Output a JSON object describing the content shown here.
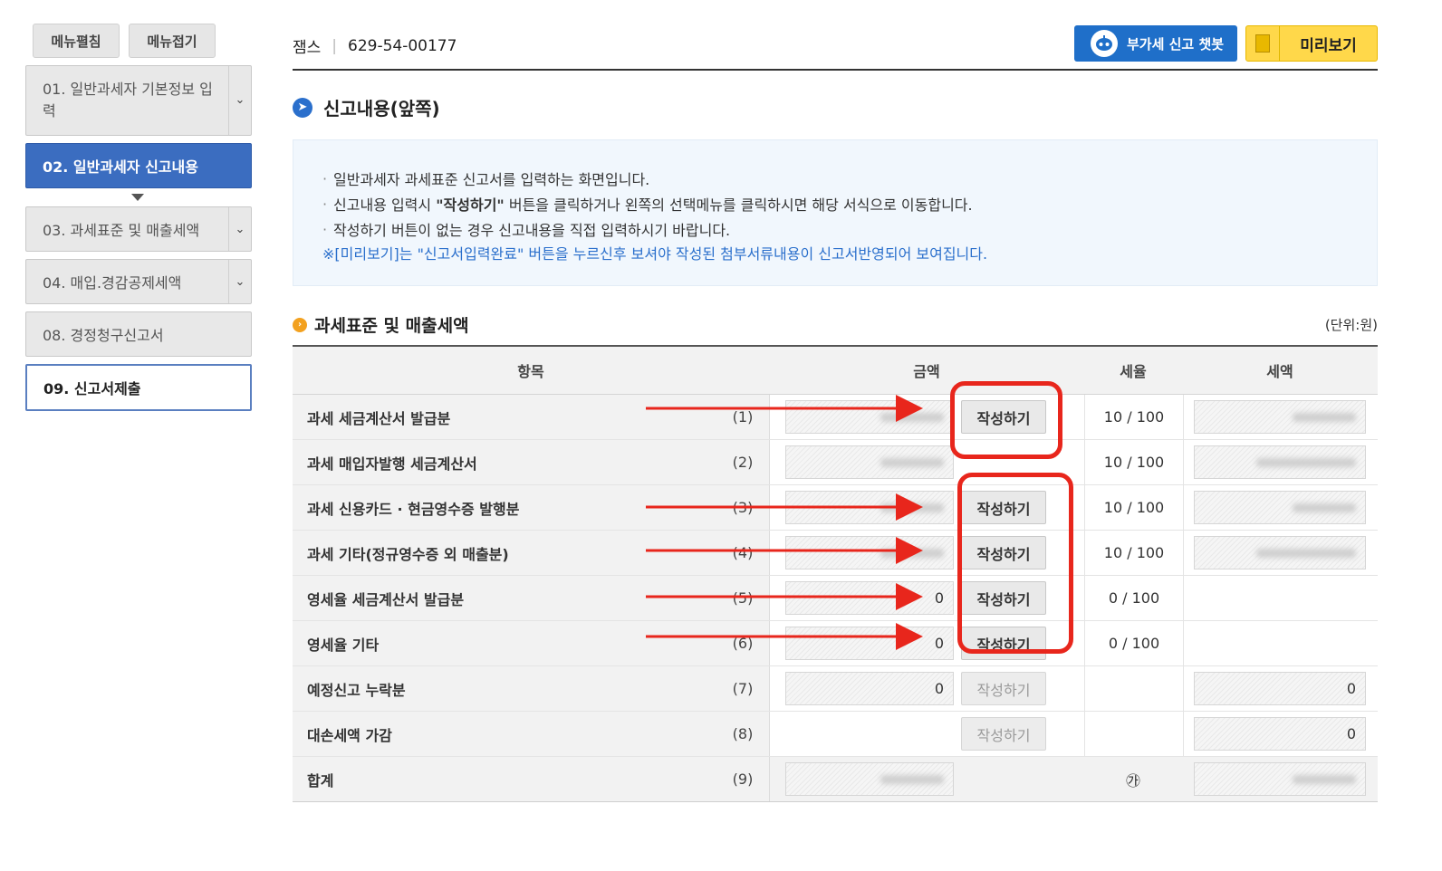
{
  "sidebar": {
    "expand_label": "메뉴펼침",
    "collapse_label": "메뉴접기",
    "items": [
      {
        "label": "01. 일반과세자 기본정보 입력"
      },
      {
        "label": "02. 일반과세자 신고내용"
      },
      {
        "label": "03. 과세표준 및 매출세액"
      },
      {
        "label": "04. 매입.경감공제세액"
      },
      {
        "label": "08. 경정청구신고서"
      },
      {
        "label": "09. 신고서제출"
      }
    ]
  },
  "header": {
    "company": "잼스",
    "separator": "|",
    "biz_number": "629-54-00177",
    "chatbot_label": "부가세 신고 챗봇",
    "preview_label": "미리보기"
  },
  "section_title": "신고내용(앞쪽)",
  "info": {
    "lines": [
      "일반과세자 과세표준 신고서를 입력하는 화면입니다.",
      "신고내용 입력시 \"작성하기\" 버튼을 클릭하거나 왼쪽의 선택메뉴를 클릭하시면 해당 서식으로 이동합니다.",
      "작성하기 버튼이 없는 경우 신고내용을 직접 입력하시기 바랍니다."
    ],
    "note": "※[미리보기]는 \"신고서입력완료\" 버튼을 누르신후 보셔야 작성된 첨부서류내용이 신고서반영되어 보여집니다."
  },
  "table_section": {
    "title": "과세표준 및 매출세액",
    "unit": "(단위:원)",
    "headers": {
      "item": "항목",
      "amount": "금액",
      "rate": "세율",
      "tax": "세액"
    },
    "write_label": "작성하기",
    "rows": [
      {
        "label": "과세 세금계산서 발급분",
        "num": "(1)",
        "amount": "",
        "rate": "10 / 100",
        "tax": ""
      },
      {
        "label": "과세 매입자발행 세금계산서",
        "num": "(2)",
        "amount": "",
        "rate": "10 / 100",
        "tax": ""
      },
      {
        "label": "과세 신용카드 · 현금영수증 발행분",
        "num": "(3)",
        "amount": "",
        "rate": "10 / 100",
        "tax": ""
      },
      {
        "label": "과세 기타(정규영수증 외 매출분)",
        "num": "(4)",
        "amount": "",
        "rate": "10 / 100",
        "tax": ""
      },
      {
        "label": "영세율 세금계산서 발급분",
        "num": "(5)",
        "amount": "0",
        "rate": "0 / 100",
        "tax": ""
      },
      {
        "label": "영세율 기타",
        "num": "(6)",
        "amount": "0",
        "rate": "0 / 100",
        "tax": ""
      },
      {
        "label": "예정신고 누락분",
        "num": "(7)",
        "amount": "0",
        "rate": "",
        "tax": "0"
      },
      {
        "label": "대손세액 가감",
        "num": "(8)",
        "amount": "",
        "rate": "",
        "tax": "0"
      },
      {
        "label": "합계",
        "num": "(9)",
        "amount": "",
        "rate": "㉮",
        "tax": ""
      }
    ]
  },
  "colors": {
    "accent_blue": "#2a6fcc",
    "sidebar_active": "#3b6dc0",
    "preview_yellow": "#ffd84a",
    "annotation_red": "#e8261c"
  }
}
